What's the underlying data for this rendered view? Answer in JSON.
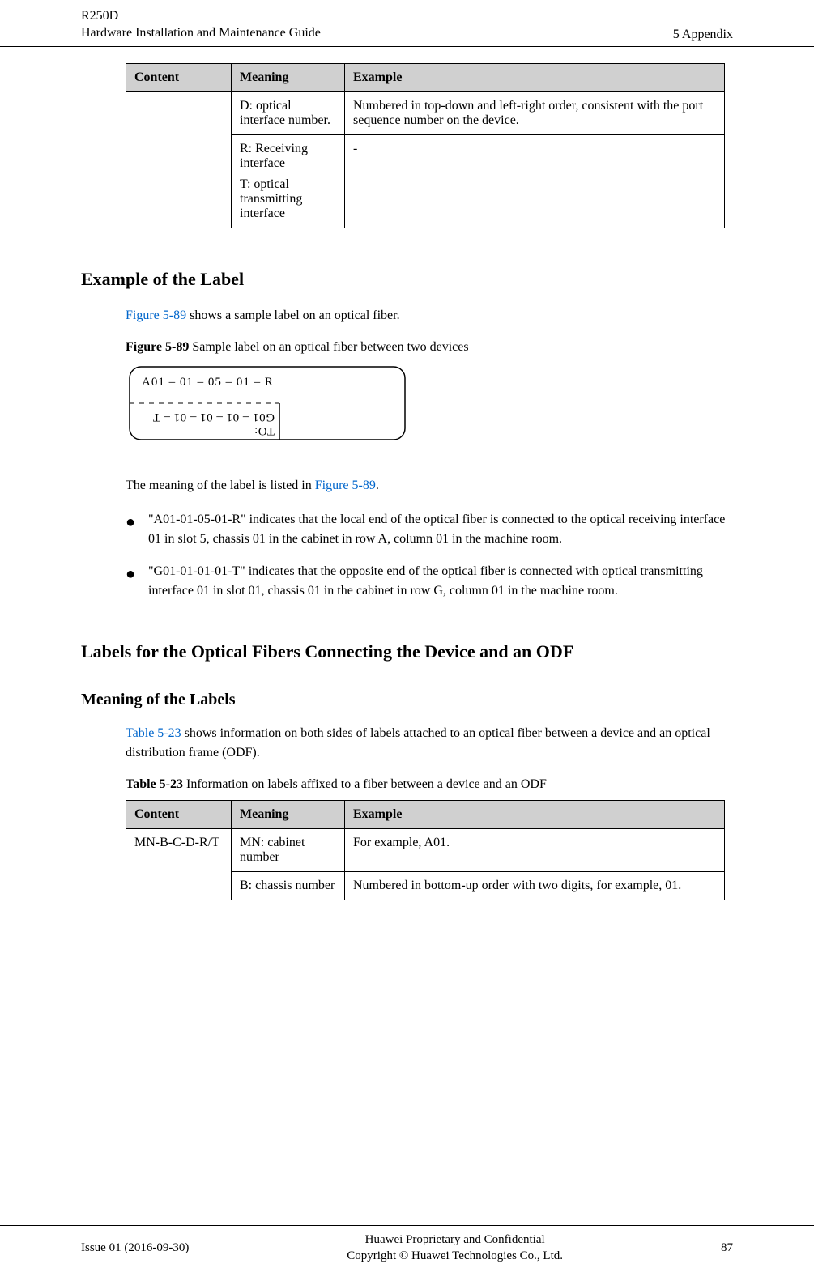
{
  "header": {
    "product": "R250D",
    "doc_title": "Hardware Installation and Maintenance Guide",
    "section": "5 Appendix"
  },
  "table1": {
    "headers": [
      "Content",
      "Meaning",
      "Example"
    ],
    "rows": [
      {
        "content": "",
        "meaning": "D: optical interface number.",
        "example": "Numbered in top-down and left-right order, consistent with the port sequence number on the device."
      },
      {
        "content": "",
        "meaning": "R: Receiving interface",
        "meaning2": "T: optical transmitting interface",
        "example": "-"
      }
    ]
  },
  "h2_example": "Example of the Label",
  "para_example": {
    "prefix": "",
    "xref": "Figure 5-89",
    "suffix": " shows a sample label on an optical fiber."
  },
  "figure_caption": {
    "bold": "Figure 5-89",
    "text": " Sample label on an optical fiber between two devices"
  },
  "label_top": "A01 – 01  – 05 – 01 –  R",
  "label_bottom_to": "TO:",
  "label_bottom_code": "G01 –  01 –  01 – 01 –  T",
  "para_meaning": {
    "prefix": "The meaning of the label is listed in ",
    "xref": "Figure 5-89",
    "suffix": "."
  },
  "bullets": [
    "\"A01-01-05-01-R\" indicates that the local end of the optical fiber is connected to the optical receiving interface 01 in slot 5, chassis 01 in the cabinet in row A, column 01 in the machine room.",
    "\"G01-01-01-01-T\" indicates that the opposite end of the optical fiber is connected with optical transmitting interface 01 in slot 01, chassis 01 in the cabinet in row G, column 01 in the machine room."
  ],
  "h2_odf": "Labels for the Optical Fibers Connecting the Device and an ODF",
  "h3_meaning": "Meaning of the Labels",
  "para_odf": {
    "xref": "Table 5-23",
    "suffix": " shows information on both sides of labels attached to an optical fiber between a device and an optical distribution frame (ODF)."
  },
  "table2_caption": {
    "bold": "Table 5-23",
    "text": " Information on labels affixed to a fiber between a device and an ODF"
  },
  "table2": {
    "headers": [
      "Content",
      "Meaning",
      "Example"
    ],
    "rows": [
      {
        "content": "MN-B-C-D-R/T",
        "meaning": "MN: cabinet number",
        "example": "For example, A01."
      },
      {
        "content": "",
        "meaning": "B: chassis number",
        "example": "Numbered in bottom-up order with two digits, for example, 01."
      }
    ]
  },
  "footer": {
    "left": "Issue 01 (2016-09-30)",
    "center1": "Huawei Proprietary and Confidential",
    "center2": "Copyright © Huawei Technologies Co., Ltd.",
    "right": "87"
  }
}
